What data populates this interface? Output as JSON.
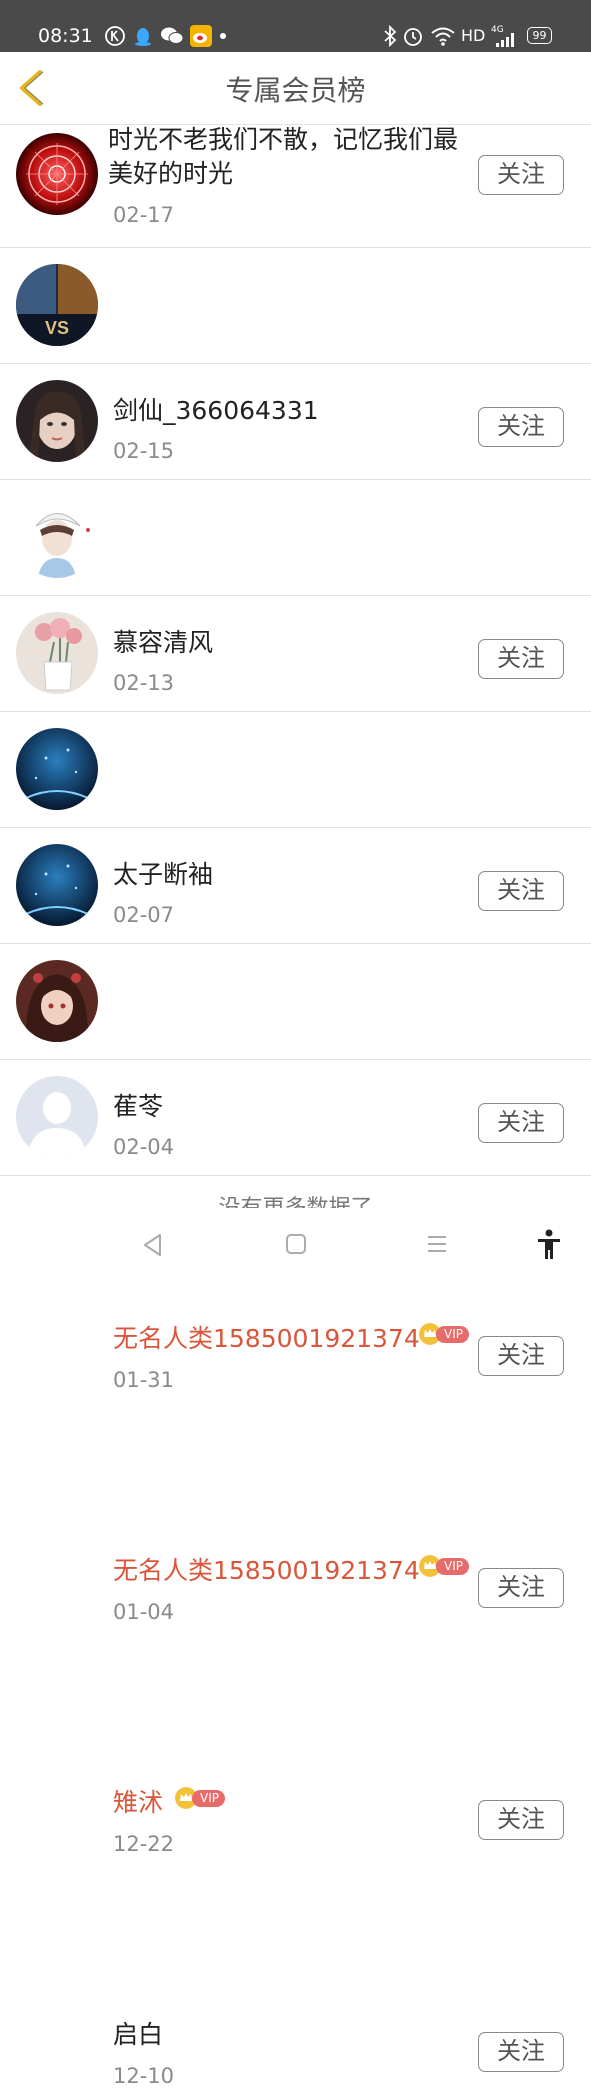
{
  "status_bar": {
    "time": "08:31",
    "left_icons": [
      "k-circle-icon",
      "qq-penguin-icon",
      "wechat-icon",
      "weibo-icon",
      "dot-icon"
    ],
    "network": "HD",
    "signal_label": "4G",
    "battery": "99"
  },
  "header": {
    "title": "专属会员榜",
    "back_icon": "chevron-left-icon",
    "accent": "#e6b422"
  },
  "members": [
    {
      "name": "时光不老我们不散，记忆我们最美好的时光",
      "date": "02-17",
      "vip": false,
      "follow": "关注",
      "avatar": "red-magic-circle"
    },
    {
      "name": "剑仙_366064331",
      "date": "02-15",
      "vip": false,
      "follow": "关注",
      "avatar": "game-vs"
    },
    {
      "name": "慕容清风",
      "date": "02-13",
      "vip": false,
      "follow": "关注",
      "avatar": "girl-portrait"
    },
    {
      "name": "太子断袖",
      "date": "02-07",
      "vip": false,
      "follow": "关注",
      "avatar": "anime-boy"
    },
    {
      "name": "萑苓",
      "date": "02-04",
      "vip": false,
      "follow": "关注",
      "avatar": "flowers-vase"
    },
    {
      "name": "无名人类1585001921374",
      "date": "01-31",
      "vip": true,
      "vip_label": "VIP",
      "follow": "关注",
      "avatar": "blue-night"
    },
    {
      "name": "无名人类1585001921374",
      "date": "01-04",
      "vip": true,
      "vip_label": "VIP",
      "follow": "关注",
      "avatar": "blue-night"
    },
    {
      "name": "雉沭",
      "date": "12-22",
      "vip": true,
      "vip_label": "VIP",
      "follow": "关注",
      "avatar": "anime-girl"
    },
    {
      "name": "启白",
      "date": "12-10",
      "vip": false,
      "follow": "关注",
      "avatar": "default-user"
    }
  ],
  "footer_text": "没有更多数据了",
  "colors": {
    "vip_name": "#d9563a",
    "vip_badge": "#e86b6b",
    "crown": "#f2c13a"
  },
  "nav_bar": [
    "back-triangle-icon",
    "home-square-icon",
    "menu-lines-icon",
    "accessibility-icon"
  ]
}
